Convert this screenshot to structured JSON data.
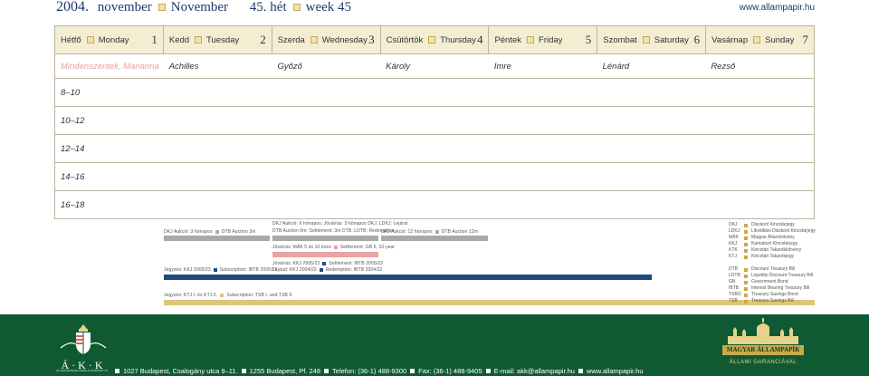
{
  "header": {
    "year": "2004.",
    "month_hu": "november",
    "month_en": "November",
    "week_hu": "45. hét",
    "week_en": "week 45",
    "url": "www.allampapir.hu"
  },
  "days": [
    {
      "hu": "Hétfő",
      "en": "Monday",
      "num": "1",
      "name": "Mindenszentek, Marianna",
      "holiday": true
    },
    {
      "hu": "Kedd",
      "en": "Tuesday",
      "num": "2",
      "name": "Achilles",
      "holiday": false
    },
    {
      "hu": "Szerda",
      "en": "Wednesday",
      "num": "3",
      "name": "Győző",
      "holiday": false
    },
    {
      "hu": "Csütörtök",
      "en": "Thursday",
      "num": "4",
      "name": "Károly",
      "holiday": false
    },
    {
      "hu": "Péntek",
      "en": "Friday",
      "num": "5",
      "name": "Imre",
      "holiday": false
    },
    {
      "hu": "Szombat",
      "en": "Saturday",
      "num": "6",
      "name": "Lénárd",
      "holiday": false
    },
    {
      "hu": "Vasárnap",
      "en": "Sunday",
      "num": "7",
      "name": "Rezső",
      "holiday": false
    }
  ],
  "time_slots": [
    "8–10",
    "10–12",
    "12–14",
    "14–16",
    "16–18"
  ],
  "legend": {
    "auction_tue": "DKJ Aukció: 3 hónapos",
    "auction_tue_en": "DTB Auction 3m",
    "auction_wed_1": "DKJ Aukció: 6 hónapos; Jóváírás: 3 hónapos DKJ, LDKJ; Lejárat",
    "auction_wed_2": "DTB Auction 6m; Settlement: 3m DTB, LDTB; Redemption",
    "auction_thu": "DKJ Aukció: 12 hónapos",
    "auction_thu_en": "DTB Auction 12m",
    "mak_wed": "Jóváírás: MÁK 5 és 10 éves",
    "mak_wed_en": "Settlement: GB 5, 10-year",
    "kkj_wed_1": "Jóváírás: KKJ 2005/22",
    "kkj_wed_1_en": "Settlement: IBTB 2005/22",
    "kkj_wed_2": "Lejárat: KKJ 2004/22",
    "kkj_wed_2_en": "Redemption: IBTB 2004/22",
    "kkj_tue": "Jegyzés: KKJ 2005/23",
    "kkj_tue_en": "Subscription: IBTB 2005/23",
    "ktj_tue": "Jegyzés: KTJ I. és KTJ II.",
    "ktj_tue_en": "Subscription: TSB I. and TSB II."
  },
  "abbreviations_hu": [
    {
      "k": "DKJ",
      "v": "Diszkont Kincstárjegy"
    },
    {
      "k": "LDKJ",
      "v": "Likviditási Diszkont Kincstárjegy"
    },
    {
      "k": "MÁK",
      "v": "Magyar Államkötvény"
    },
    {
      "k": "KKJ",
      "v": "Kamatozó Kincstárjegy"
    },
    {
      "k": "KTK",
      "v": "Kincstári Takarékkötvény"
    },
    {
      "k": "KTJ",
      "v": "Kincstári Takarékjegy"
    }
  ],
  "abbreviations_en": [
    {
      "k": "DTB",
      "v": "Discount Treasury Bill"
    },
    {
      "k": "LDTB",
      "v": "Liquidity Discount Treasury Bill"
    },
    {
      "k": "GB",
      "v": "Government Bond"
    },
    {
      "k": "IBTB",
      "v": "Interest Bearing Treasury Bill"
    },
    {
      "k": "TSBO",
      "v": "Treasury Savings Bond"
    },
    {
      "k": "TSB",
      "v": "Treasury Savings Bill"
    }
  ],
  "footer": {
    "logo_left": "Á·K·K",
    "logo_left_sub": "ÁLLAMADÓSSÁG KEZELŐ KÖZPONT RT.",
    "address": "1027 Budapest, Csalogány utca 9–11.",
    "postal": "1255 Budapest, Pf. 248",
    "phone": "Telefon: (36-1) 488-9300",
    "fax": "Fax: (36-1) 488-9405",
    "email": "E-mail: akk@allampapir.hu",
    "web": "www.allampapir.hu",
    "logo_right": "MAGYAR ÁLLAMPAPÍR",
    "logo_right_sub": "ÁLLAMI GARANCIÁVAL"
  },
  "colors": {
    "gray_bar": "#a9a9a9",
    "pink_bar": "#e8a3a3",
    "blue_bar": "#1e4c7a",
    "gold_bar": "#dcc777",
    "footer_green": "#0f5a33"
  }
}
